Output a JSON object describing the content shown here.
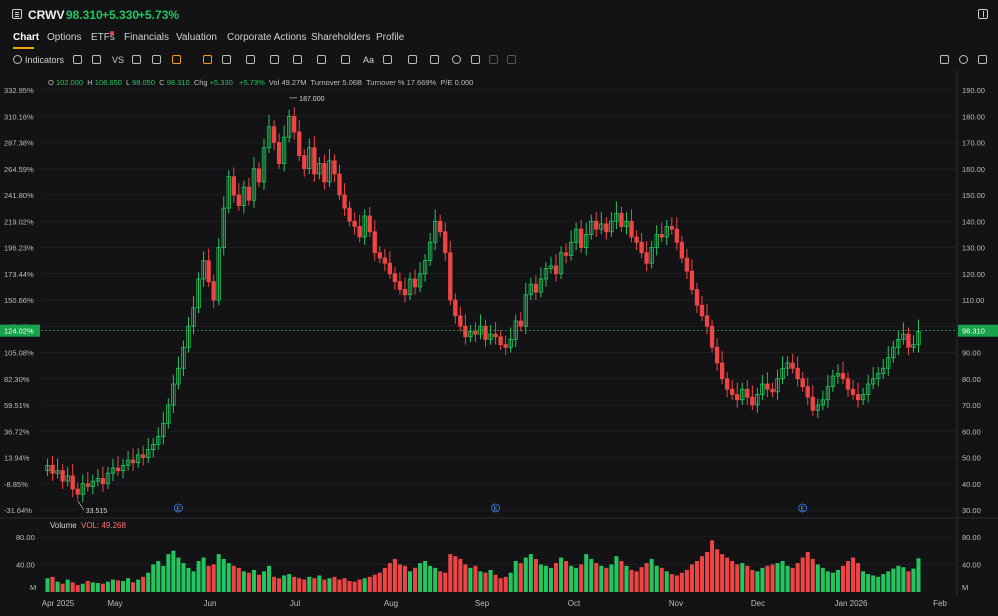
{
  "header": {
    "ticker": "CRWV",
    "price": "98.310",
    "change": "+5.330",
    "change_pct": "+5.73%"
  },
  "tabs": [
    {
      "label": "Chart",
      "active": true
    },
    {
      "label": "Options"
    },
    {
      "label": "ETFs",
      "badge": true
    },
    {
      "label": "Financials"
    },
    {
      "label": "Valuation"
    },
    {
      "label": "Corporate Actions"
    },
    {
      "label": "Shareholders"
    },
    {
      "label": "Profile"
    }
  ],
  "toolbar": {
    "indicators_label": "Indicators",
    "vs_label": "VS",
    "text_tool_label": "Aa"
  },
  "ohlc": {
    "o_label": "O",
    "o": "102.000",
    "h_label": "H",
    "h": "108.650",
    "l_label": "L",
    "l": "98.050",
    "c_label": "C",
    "c": "98.310",
    "chg_label": "Chg",
    "chg": "+5.330",
    "chg_pct": "+5.73%",
    "vol_label": "Vol",
    "vol": "49.27M",
    "turnover_label": "Turnover",
    "turnover": "5.06B",
    "turnover_pct_label": "Turnover %",
    "turnover_pct": "17.669%",
    "pe_label": "P/E",
    "pe": "0.000"
  },
  "volume_panel": {
    "label": "Volume",
    "value_label": "VOL: 49.268"
  },
  "colors": {
    "up": "#22c55e",
    "down": "#ef4444",
    "accent": "#f59e0b",
    "background": "#131316"
  },
  "chart_data": {
    "type": "candlestick",
    "left_axis_ticks": [
      "332.95%",
      "310.16%",
      "287.38%",
      "264.59%",
      "241.80%",
      "219.02%",
      "196.23%",
      "173.44%",
      "150.66%",
      "127.87%",
      "105.08%",
      "82.30%",
      "59.51%",
      "36.72%",
      "13.94%",
      "-8.85%",
      "-31.64%"
    ],
    "right_axis_ticks": [
      "190.000",
      "180.000",
      "170.000",
      "160.000",
      "150.000",
      "140.000",
      "130.000",
      "120.000",
      "110.000",
      "100.000",
      "90.000",
      "80.000",
      "70.000",
      "60.000",
      "50.000",
      "40.000",
      "30.000"
    ],
    "right_axis_ticks_visible": [
      "190.00",
      "180.00",
      "170.00",
      "160.00",
      "150.00",
      "140.00",
      "130.00",
      "120.00",
      "110.00",
      "",
      "90.00",
      "80.00",
      "70.00",
      "60.00",
      "50.00",
      "40.00",
      "30.00"
    ],
    "ylim": [
      30,
      190
    ],
    "current_price_label": "98.310",
    "current_pct_label": "124.02%",
    "current_price": 98.31,
    "max_annotation": "187.000",
    "max_value": 187.0,
    "min_annotation": "33.515",
    "min_value": 33.515,
    "x_labels": [
      "Apr 2025",
      "May",
      "Jun",
      "Jul",
      "Aug",
      "Sep",
      "Oct",
      "Nov",
      "Dec",
      "Jan 2026",
      "Feb"
    ],
    "earnings_markers": [
      "E",
      "E",
      "E"
    ],
    "volume_axis_ticks": [
      "80.00",
      "40.00",
      "M"
    ],
    "volume_ylim": [
      0,
      90
    ],
    "closes": [
      47,
      44,
      45,
      41,
      43,
      38,
      36,
      40,
      39,
      41,
      42,
      40,
      44,
      46,
      45,
      47,
      49,
      48,
      51,
      50,
      53,
      55,
      58,
      63,
      70,
      78,
      84,
      92,
      100,
      107,
      118,
      125,
      117,
      110,
      130,
      145,
      157,
      150,
      146,
      153,
      148,
      160,
      155,
      168,
      176,
      170,
      162,
      172,
      180,
      174,
      165,
      160,
      168,
      158,
      162,
      155,
      163,
      158,
      150,
      145,
      140,
      138,
      134,
      142,
      136,
      128,
      126,
      124,
      120,
      117,
      114,
      112,
      118,
      115,
      120,
      125,
      132,
      140,
      136,
      128,
      110,
      104,
      100,
      96,
      98,
      97,
      100,
      95,
      97,
      96,
      93,
      92,
      95,
      102,
      100,
      112,
      116,
      113,
      118,
      122,
      123,
      120,
      128,
      127,
      132,
      137,
      130,
      135,
      140,
      137,
      139,
      136,
      140,
      143,
      138,
      140,
      134,
      132,
      128,
      124,
      130,
      135,
      134,
      138,
      137,
      132,
      126,
      121,
      114,
      108,
      104,
      100,
      92,
      86,
      80,
      76,
      74,
      72,
      76,
      73,
      70,
      74,
      78,
      76,
      75,
      80,
      84,
      86,
      84,
      80,
      77,
      73,
      68,
      70,
      72,
      77,
      81,
      82,
      80,
      76,
      74,
      72,
      74,
      78,
      80,
      82,
      84,
      88,
      92,
      95,
      97,
      92,
      93,
      98
    ],
    "volumes": [
      20,
      22,
      15,
      12,
      18,
      14,
      10,
      12,
      16,
      14,
      13,
      12,
      15,
      18,
      17,
      16,
      20,
      14,
      18,
      22,
      28,
      40,
      45,
      38,
      55,
      60,
      50,
      42,
      35,
      30,
      45,
      50,
      38,
      40,
      55,
      48,
      42,
      38,
      35,
      30,
      28,
      32,
      25,
      30,
      38,
      22,
      20,
      24,
      26,
      22,
      20,
      18,
      22,
      20,
      24,
      18,
      20,
      22,
      18,
      20,
      16,
      15,
      18,
      20,
      22,
      25,
      28,
      35,
      42,
      48,
      40,
      38,
      30,
      35,
      42,
      45,
      38,
      35,
      30,
      28,
      55,
      52,
      48,
      40,
      35,
      38,
      30,
      28,
      32,
      25,
      20,
      22,
      28,
      45,
      42,
      50,
      55,
      48,
      40,
      38,
      35,
      42,
      50,
      45,
      38,
      35,
      40,
      55,
      48,
      42,
      38,
      35,
      40,
      52,
      45,
      38,
      32,
      30,
      36,
      42,
      48,
      38,
      35,
      30,
      26,
      24,
      28,
      32,
      40,
      45,
      52,
      58,
      75,
      62,
      55,
      50,
      45,
      40,
      42,
      38,
      32,
      30,
      35,
      38,
      40,
      42,
      45,
      38,
      35,
      42,
      50,
      58,
      48,
      40,
      35,
      30,
      28,
      32,
      38,
      45,
      50,
      42,
      30,
      26,
      24,
      22,
      26,
      30,
      34,
      38,
      36,
      30,
      34,
      49
    ]
  }
}
